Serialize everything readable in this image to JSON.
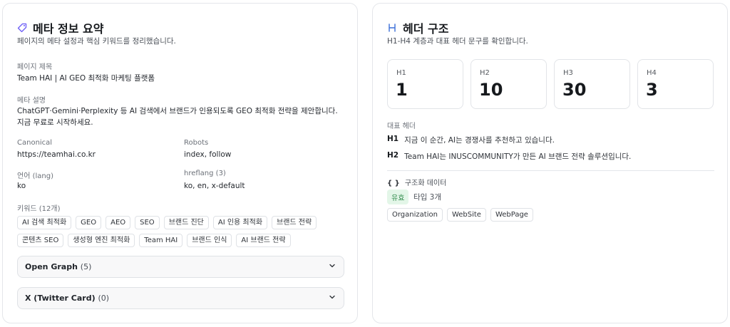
{
  "meta": {
    "title": "메타 정보 요약",
    "subtitle": "페이지의 메타 설정과 핵심 키워드를 정리했습니다.",
    "page_title_label": "페이지 제목",
    "page_title_value": "Team HAI | AI GEO 최적화 마케팅 플랫폼",
    "desc_label": "메타 설명",
    "desc_value": "ChatGPT·Gemini·Perplexity 등 AI 검색에서 브랜드가 인용되도록 GEO 최적화 전략을 제안합니다. 지금 무료로 시작하세요.",
    "canonical_label": "Canonical",
    "canonical_value": "https://teamhai.co.kr",
    "robots_label": "Robots",
    "robots_value": "index, follow",
    "lang_label": "언어 (lang)",
    "lang_value": "ko",
    "hreflang_label": "hreflang (3)",
    "hreflang_value": "ko, en, x-default",
    "keywords_label": "키워드 (12개)",
    "keywords": [
      "AI 검색 최적화",
      "GEO",
      "AEO",
      "SEO",
      "브랜드 진단",
      "AI 인용 최적화",
      "브랜드 전략",
      "콘텐츠 SEO",
      "생성형 엔진 최적화",
      "Team HAI",
      "브랜드 인식",
      "AI 브랜드 전략"
    ],
    "og_label": "Open Graph",
    "og_count": "(5)",
    "twitter_label": "X (Twitter Card)",
    "twitter_count": "(0)"
  },
  "headers": {
    "title": "헤더 구조",
    "subtitle": "H1-H4 계층과 대표 헤더 문구를 확인합니다.",
    "stats": [
      {
        "label": "H1",
        "value": "1"
      },
      {
        "label": "H2",
        "value": "10"
      },
      {
        "label": "H3",
        "value": "30"
      },
      {
        "label": "H4",
        "value": "3"
      }
    ],
    "rep_label": "대표 헤더",
    "rep": [
      {
        "tag": "H1",
        "text": "지금 이 순간, AI는 경쟁사를 추천하고 있습니다."
      },
      {
        "tag": "H2",
        "text": "Team HAI는 INUSCOMMUNITY가 만든 AI 브랜드 전략 솔루션입니다."
      }
    ],
    "structured_label": "구조화 데이터",
    "structured_icon": "{ }",
    "badge": "유효",
    "types_count": "타입 3개",
    "types": [
      "Organization",
      "WebSite",
      "WebPage"
    ]
  },
  "colors": {
    "accent_tag_icon": "#6b5cf6",
    "accent_h_icon": "#3b6fd8",
    "valid_badge_bg": "#e3f6e8",
    "valid_badge_text": "#2f8a4a"
  }
}
